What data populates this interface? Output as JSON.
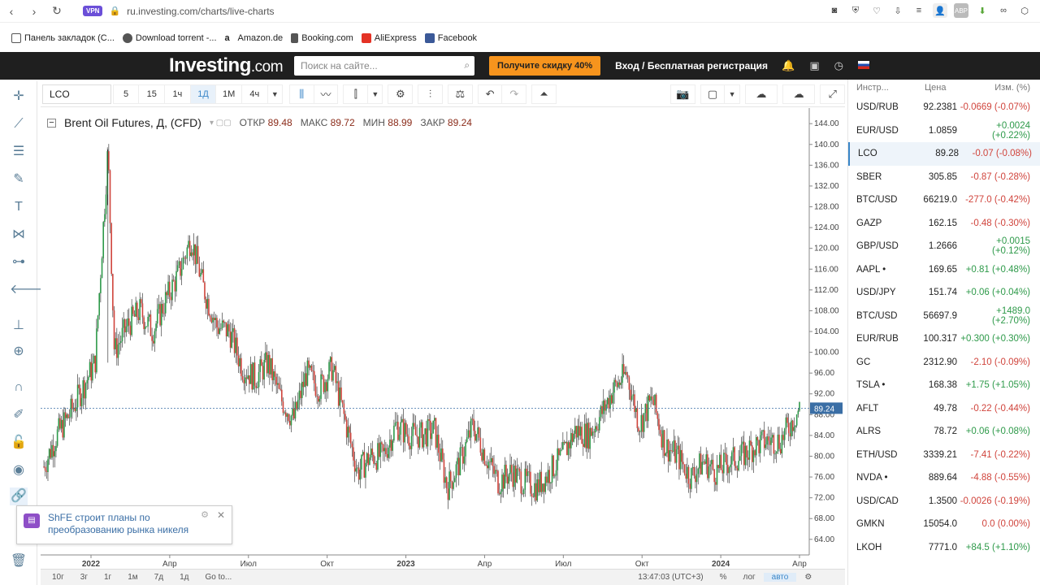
{
  "browser": {
    "url": "ru.investing.com/charts/live-charts",
    "vpn_label": "VPN",
    "bookmarks": [
      {
        "label": "Панель закладок (C..."
      },
      {
        "label": "Download torrent -..."
      },
      {
        "label": "Amazon.de"
      },
      {
        "label": "Booking.com"
      },
      {
        "label": "AliExpress"
      },
      {
        "label": "Facebook"
      }
    ]
  },
  "header": {
    "logo_main": "Investing",
    "logo_suffix": ".com",
    "search_placeholder": "Поиск на сайте...",
    "promo_label": "Получите скидку 40%",
    "login_label": "Вход / Бесплатная регистрация"
  },
  "toolbar": {
    "symbol": "LCO",
    "timeframes": [
      "5",
      "15",
      "1ч",
      "1Д",
      "1М",
      "4ч"
    ],
    "active_timeframe": "1Д"
  },
  "chart": {
    "title": "Brent Oil Futures, Д, (CFD)",
    "ohlc": [
      {
        "label": "ОТКР",
        "value": "89.48"
      },
      {
        "label": "МАКС",
        "value": "89.72"
      },
      {
        "label": "МИН",
        "value": "88.99"
      },
      {
        "label": "ЗАКР",
        "value": "89.24"
      }
    ],
    "last_price_label": "89.24"
  },
  "chart_data": {
    "type": "candlestick",
    "y_ticks": [
      64,
      68,
      72,
      76,
      80,
      84,
      88,
      92,
      96,
      100,
      104,
      108,
      112,
      116,
      120,
      124,
      128,
      132,
      136,
      140,
      144
    ],
    "ylim": [
      61,
      147
    ],
    "x_tick_labels": [
      "2022",
      "Апр",
      "Июл",
      "Окт",
      "2023",
      "Апр",
      "Июл",
      "Окт",
      "2024",
      "Апр"
    ],
    "last_price": 89.24,
    "series": [
      {
        "name": "",
        "values": [
          [
            "2021-12-27",
            78
          ],
          [
            "2022-01-10",
            84
          ],
          [
            "2022-01-24",
            88
          ],
          [
            "2022-02-07",
            93
          ],
          [
            "2022-02-21",
            98
          ],
          [
            "2022-03-07",
            139
          ],
          [
            "2022-03-14",
            100
          ],
          [
            "2022-03-28",
            105
          ],
          [
            "2022-04-11",
            108
          ],
          [
            "2022-04-25",
            104
          ],
          [
            "2022-05-09",
            110
          ],
          [
            "2022-05-23",
            115
          ],
          [
            "2022-06-06",
            122
          ],
          [
            "2022-06-20",
            112
          ],
          [
            "2022-07-04",
            105
          ],
          [
            "2022-07-18",
            104
          ],
          [
            "2022-08-01",
            97
          ],
          [
            "2022-08-15",
            95
          ],
          [
            "2022-08-29",
            98
          ],
          [
            "2022-09-12",
            91
          ],
          [
            "2022-09-26",
            87
          ],
          [
            "2022-10-10",
            96
          ],
          [
            "2022-10-24",
            93
          ],
          [
            "2022-11-07",
            97
          ],
          [
            "2022-11-21",
            87
          ],
          [
            "2022-12-05",
            77
          ],
          [
            "2022-12-19",
            80
          ],
          [
            "2023-01-02",
            80
          ],
          [
            "2023-01-16",
            86
          ],
          [
            "2023-01-30",
            84
          ],
          [
            "2023-02-13",
            84
          ],
          [
            "2023-02-27",
            85
          ],
          [
            "2023-03-13",
            74
          ],
          [
            "2023-03-27",
            79
          ],
          [
            "2023-04-10",
            86
          ],
          [
            "2023-04-24",
            80
          ],
          [
            "2023-05-08",
            75
          ],
          [
            "2023-05-22",
            77
          ],
          [
            "2023-06-05",
            75
          ],
          [
            "2023-06-19",
            74
          ],
          [
            "2023-07-03",
            77
          ],
          [
            "2023-07-17",
            80
          ],
          [
            "2023-07-31",
            85
          ],
          [
            "2023-08-14",
            84
          ],
          [
            "2023-08-28",
            88
          ],
          [
            "2023-09-11",
            93
          ],
          [
            "2023-09-25",
            96
          ],
          [
            "2023-10-09",
            86
          ],
          [
            "2023-10-23",
            91
          ],
          [
            "2023-11-06",
            82
          ],
          [
            "2023-11-20",
            80
          ],
          [
            "2023-12-04",
            76
          ],
          [
            "2023-12-18",
            79
          ],
          [
            "2024-01-01",
            77
          ],
          [
            "2024-01-15",
            79
          ],
          [
            "2024-01-29",
            80
          ],
          [
            "2024-02-12",
            82
          ],
          [
            "2024-02-26",
            83
          ],
          [
            "2024-03-11",
            83
          ],
          [
            "2024-03-25",
            87
          ],
          [
            "2024-04-01",
            89.24
          ]
        ]
      }
    ]
  },
  "bottom_bar": {
    "ranges": [
      "10г",
      "3г",
      "1г",
      "1м",
      "7д",
      "1д"
    ],
    "goto": "Go to...",
    "time": "13:47:03 (UTC+3)",
    "pct": "%",
    "log": "лог",
    "auto": "авто"
  },
  "news": {
    "icon": "news-icon",
    "text": "ShFE строит планы по преобразованию рынка никеля"
  },
  "watchlist": {
    "headers": {
      "name": "Инстр...",
      "price": "Цена",
      "change": "Изм. (%)"
    },
    "rows": [
      {
        "name": "USD/RUB",
        "price": "92.2381",
        "change": "-0.0669 (-0.07%)",
        "dir": "neg"
      },
      {
        "name": "EUR/USD",
        "price": "1.0859",
        "change": "+0.0024 (+0.22%)",
        "dir": "pos"
      },
      {
        "name": "LCO",
        "price": "89.28",
        "change": "-0.07 (-0.08%)",
        "dir": "neg",
        "active": true
      },
      {
        "name": "SBER",
        "price": "305.85",
        "change": "-0.87 (-0.28%)",
        "dir": "neg"
      },
      {
        "name": "BTC/USD",
        "price": "66219.0",
        "change": "-277.0 (-0.42%)",
        "dir": "neg"
      },
      {
        "name": "GAZP",
        "price": "162.15",
        "change": "-0.48 (-0.30%)",
        "dir": "neg"
      },
      {
        "name": "GBP/USD",
        "price": "1.2666",
        "change": "+0.0015 (+0.12%)",
        "dir": "pos"
      },
      {
        "name": "AAPL •",
        "price": "169.65",
        "change": "+0.81 (+0.48%)",
        "dir": "pos"
      },
      {
        "name": "USD/JPY",
        "price": "151.74",
        "change": "+0.06 (+0.04%)",
        "dir": "pos"
      },
      {
        "name": "BTC/USD",
        "price": "56697.9",
        "change": "+1489.0 (+2.70%)",
        "dir": "pos"
      },
      {
        "name": "EUR/RUB",
        "price": "100.317",
        "change": "+0.300 (+0.30%)",
        "dir": "pos"
      },
      {
        "name": "GC",
        "price": "2312.90",
        "change": "-2.10 (-0.09%)",
        "dir": "neg"
      },
      {
        "name": "TSLA •",
        "price": "168.38",
        "change": "+1.75 (+1.05%)",
        "dir": "pos"
      },
      {
        "name": "AFLT",
        "price": "49.78",
        "change": "-0.22 (-0.44%)",
        "dir": "neg"
      },
      {
        "name": "ALRS",
        "price": "78.72",
        "change": "+0.06 (+0.08%)",
        "dir": "pos"
      },
      {
        "name": "ETH/USD",
        "price": "3339.21",
        "change": "-7.41 (-0.22%)",
        "dir": "neg"
      },
      {
        "name": "NVDA •",
        "price": "889.64",
        "change": "-4.88 (-0.55%)",
        "dir": "neg"
      },
      {
        "name": "USD/CAD",
        "price": "1.3500",
        "change": "-0.0026 (-0.19%)",
        "dir": "neg"
      },
      {
        "name": "GMKN",
        "price": "15054.0",
        "change": "0.0 (0.00%)",
        "dir": "neg"
      },
      {
        "name": "LKOH",
        "price": "7771.0",
        "change": "+84.5 (+1.10%)",
        "dir": "pos"
      }
    ]
  },
  "colors": {
    "up": "#2e9a4a",
    "down": "#d0443c",
    "accent": "#3a86c8",
    "header_bg": "#1f1f1f",
    "promo": "#f7941d"
  }
}
